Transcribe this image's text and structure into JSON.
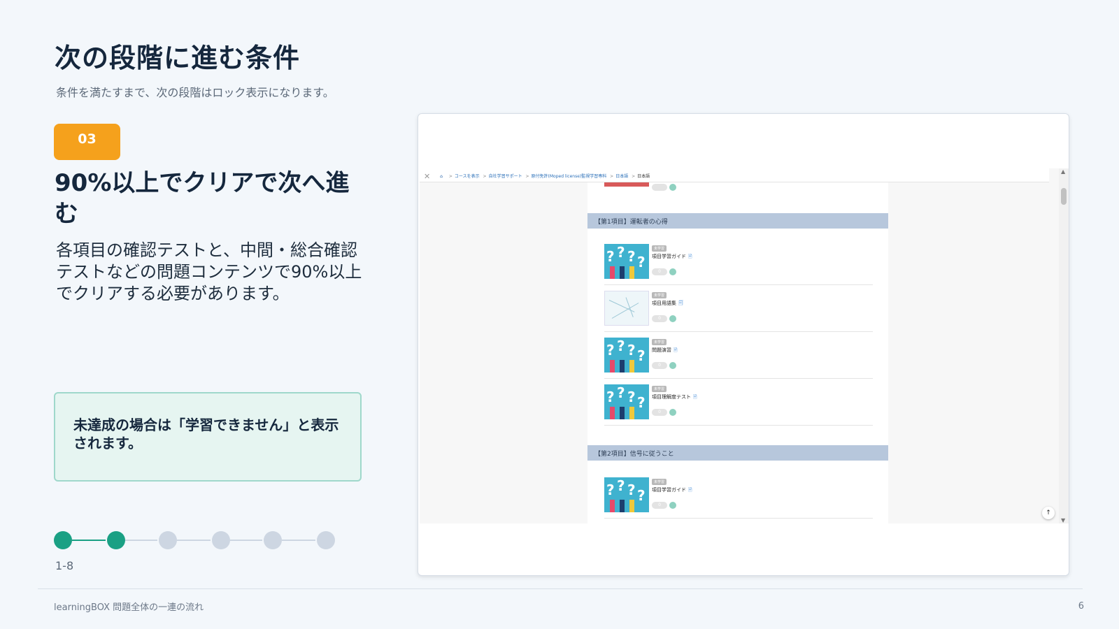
{
  "slide": {
    "title": "次の段階に進む条件",
    "subtitle": "条件を満たすまで、次の段階はロック表示になります。",
    "step_badge": "03",
    "step_heading": "90%以上でクリアで次へ進む",
    "step_description": "各項目の確認テストと、中間・総合確認テストなどの問題コンテンツで90%以上でクリアする必要があります。",
    "note": "未達成の場合は「学習できません」と表示されます。",
    "progress": {
      "label": "1-8",
      "total_steps": 6,
      "completed_steps": 2
    },
    "footer_left": "learningBOX 問題全体の一連の流れ",
    "page_number": "6"
  },
  "colors": {
    "accent_orange": "#f5a11c",
    "accent_green": "#1aa084",
    "inactive": "#cdd6e2",
    "note_bg": "#e6f5f1"
  },
  "screenshot": {
    "breadcrumb": [
      "コースを表示",
      "自社学習サポート",
      "原付免許(Moped license)監視学習専科",
      "日本語",
      "日本語"
    ],
    "icons": {
      "close": "close-icon",
      "home": "home-icon",
      "back_to_top": "arrow-up-icon"
    },
    "sections": [
      {
        "title": "【第1項目】運転者の心得",
        "items": [
          {
            "tag": "未学習",
            "name": "項目学習ガイド",
            "count": "0"
          },
          {
            "tag": "未学習",
            "name": "項目用語集",
            "count": "0"
          },
          {
            "tag": "未学習",
            "name": "問題演習",
            "count": "0"
          },
          {
            "tag": "未学習",
            "name": "項目理解度テスト",
            "count": "0"
          }
        ]
      },
      {
        "title": "【第2項目】信号に従うこと",
        "items": [
          {
            "tag": "未学習",
            "name": "項目学習ガイド",
            "count": "0"
          }
        ]
      }
    ]
  }
}
